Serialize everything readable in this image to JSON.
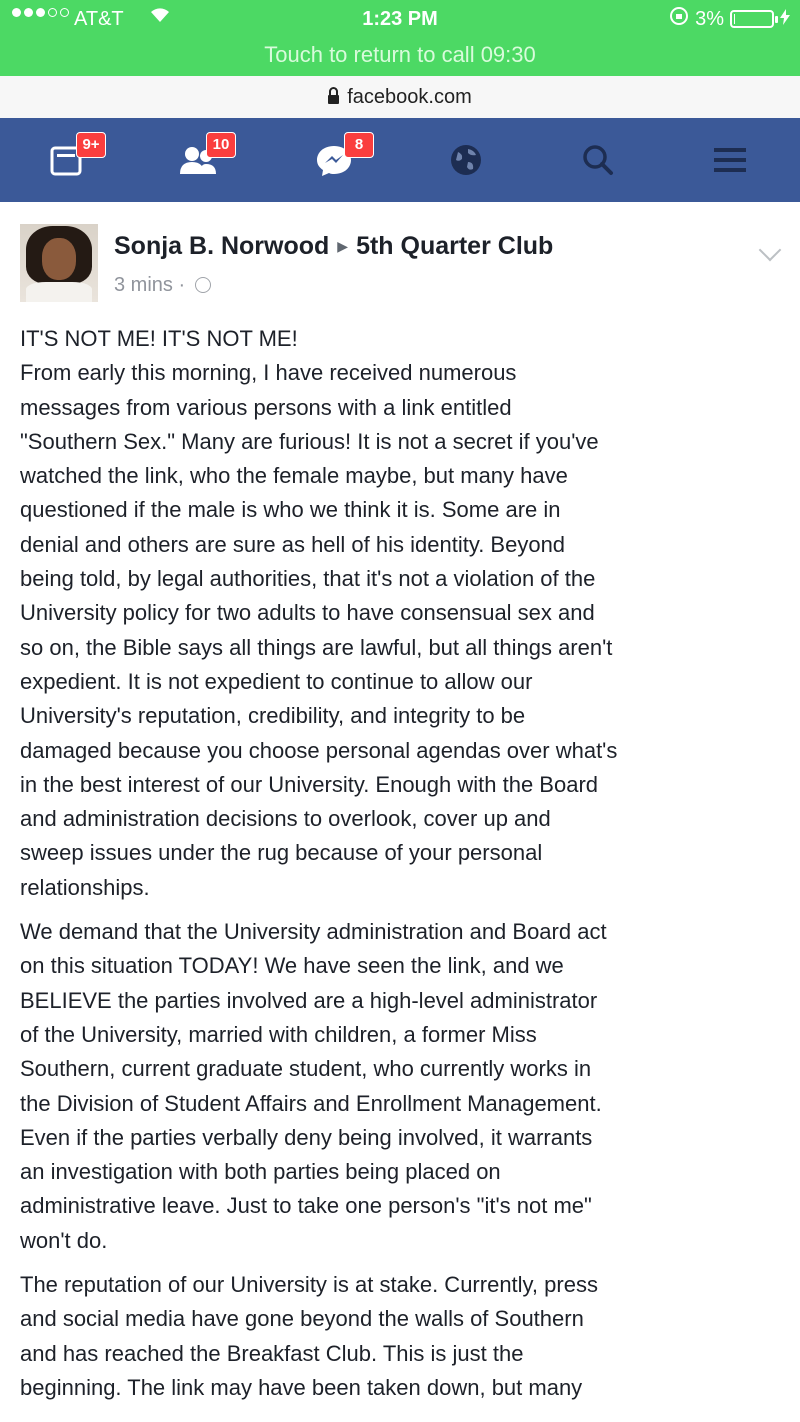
{
  "status_bar": {
    "carrier": "AT&T",
    "time": "1:23 PM",
    "battery_percent": "3%",
    "battery_level": 0.03,
    "call_banner": "Touch to return to call 09:30"
  },
  "browser": {
    "url": "facebook.com"
  },
  "nav": {
    "items": [
      {
        "icon": "news-feed-icon",
        "badge": "9+"
      },
      {
        "icon": "friend-requests-icon",
        "badge": "10"
      },
      {
        "icon": "messages-icon",
        "badge": "8"
      },
      {
        "icon": "notifications-globe-icon",
        "badge": ""
      },
      {
        "icon": "search-icon",
        "badge": ""
      },
      {
        "icon": "menu-icon",
        "badge": ""
      }
    ]
  },
  "post": {
    "author": "Sonja B. Norwood",
    "group": "5th Quarter Club",
    "time": "3 mins",
    "paragraphs": [
      "IT'S NOT ME! IT'S NOT ME!\nFrom early this morning, I have received numerous\nmessages from various persons with a link entitled\n\"Southern Sex.\" Many are furious! It is not a secret if you've\nwatched the link, who the female maybe, but many have\nquestioned if the male is who we think it is. Some are in\ndenial and others are sure as hell of his identity. Beyond\nbeing told, by legal authorities, that it's not a violation of the\nUniversity policy for two adults to have consensual sex and\nso on, the Bible says all things are lawful, but all things aren't\nexpedient. It is not expedient to continue to allow our\nUniversity's reputation, credibility, and integrity to be\ndamaged because you choose personal agendas over what's\nin the best interest of our University. Enough with the Board\nand administration decisions to overlook, cover up and\nsweep issues under the rug because of your personal\nrelationships.",
      "We demand that the University administration and Board act\non this situation TODAY! We have seen the link, and we\nBELIEVE the parties involved are a high-level administrator\nof the University, married with children, a former Miss\nSouthern, current graduate student, who currently works in\nthe Division of Student Affairs and Enrollment Management.\nEven if the parties verbally deny being involved, it warrants\nan investigation with both parties being placed on\nadministrative leave. Just to take one person's \"it's not me\"\nwon't do.",
      "The reputation of our University is at stake. Currently, press\nand social media have gone beyond the walls of Southern\nand has reached the Breakfast Club. This is just the\nbeginning. The link may have been taken down, but many"
    ]
  }
}
